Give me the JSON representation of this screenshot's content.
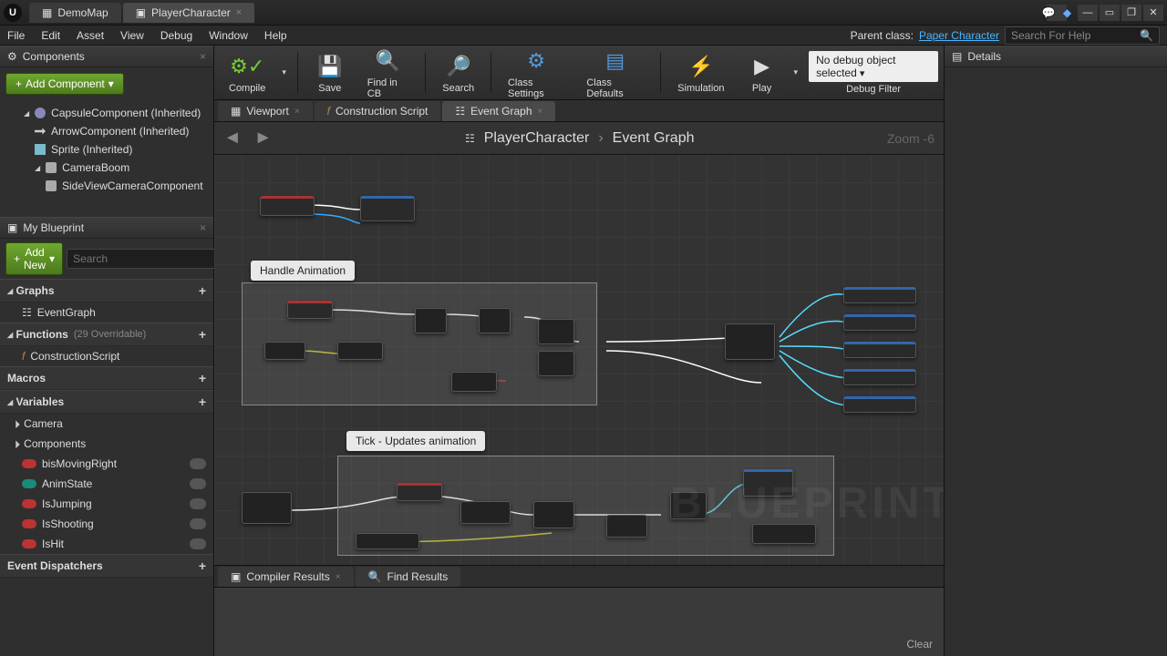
{
  "titlebar": {
    "tabs": [
      {
        "label": "DemoMap",
        "active": false
      },
      {
        "label": "PlayerCharacter",
        "active": true
      }
    ]
  },
  "menubar": {
    "items": [
      "File",
      "Edit",
      "Asset",
      "View",
      "Debug",
      "Window",
      "Help"
    ],
    "parent_class_label": "Parent class:",
    "parent_class_value": "Paper Character",
    "search_placeholder": "Search For Help"
  },
  "components_panel": {
    "title": "Components",
    "add_button": "Add Component",
    "items": [
      {
        "label": "CapsuleComponent (Inherited)",
        "depth": 1,
        "icon": "cap",
        "expand": true
      },
      {
        "label": "ArrowComponent (Inherited)",
        "depth": 2,
        "icon": "arr"
      },
      {
        "label": "Sprite (Inherited)",
        "depth": 2,
        "icon": "spr"
      },
      {
        "label": "CameraBoom",
        "depth": 2,
        "icon": "cam",
        "expand": true
      },
      {
        "label": "SideViewCameraComponent",
        "depth": 3,
        "icon": "cam"
      }
    ]
  },
  "myblueprint_panel": {
    "title": "My Blueprint",
    "add_button": "Add New",
    "search_placeholder": "Search",
    "sections": {
      "graphs": {
        "title": "Graphs",
        "items": [
          "EventGraph"
        ]
      },
      "functions": {
        "title": "Functions",
        "sub": "(29 Overridable)",
        "items": [
          "ConstructionScript"
        ]
      },
      "macros": {
        "title": "Macros"
      },
      "variables": {
        "title": "Variables",
        "groups": [
          {
            "name": "Camera"
          },
          {
            "name": "Components"
          }
        ],
        "vars": [
          {
            "name": "bisMovingRight",
            "color": "red"
          },
          {
            "name": "AnimState",
            "color": "teal"
          },
          {
            "name": "IsJumping",
            "color": "red"
          },
          {
            "name": "IsShooting",
            "color": "red"
          },
          {
            "name": "IsHit",
            "color": "red"
          }
        ]
      },
      "dispatchers": {
        "title": "Event Dispatchers"
      }
    }
  },
  "toolbar": {
    "buttons": [
      {
        "label": "Compile",
        "icon": "✔️"
      },
      {
        "label": "Save",
        "icon": "💾"
      },
      {
        "label": "Find in CB",
        "icon": "🔍"
      },
      {
        "label": "Search",
        "icon": "🔍"
      },
      {
        "label": "Class Settings",
        "icon": "⚙️"
      },
      {
        "label": "Class Defaults",
        "icon": "📋"
      },
      {
        "label": "Simulation",
        "icon": "🎮"
      },
      {
        "label": "Play",
        "icon": "▶"
      }
    ],
    "debug_combo": "No debug object selected",
    "debug_label": "Debug Filter"
  },
  "editor_tabs": [
    {
      "label": "Viewport",
      "active": false
    },
    {
      "label": "Construction Script",
      "fx": true,
      "active": false
    },
    {
      "label": "Event Graph",
      "active": true
    }
  ],
  "breadcrumb": {
    "root": "PlayerCharacter",
    "leaf": "Event Graph",
    "zoom": "Zoom -6"
  },
  "graph": {
    "comment1": "Handle Animation",
    "comment2": "Tick - Updates animation"
  },
  "bottom_tabs": [
    "Compiler Results",
    "Find Results"
  ],
  "compiler": {
    "clear": "Clear"
  },
  "details_panel": {
    "title": "Details"
  },
  "watermark": "BLUEPRINT"
}
